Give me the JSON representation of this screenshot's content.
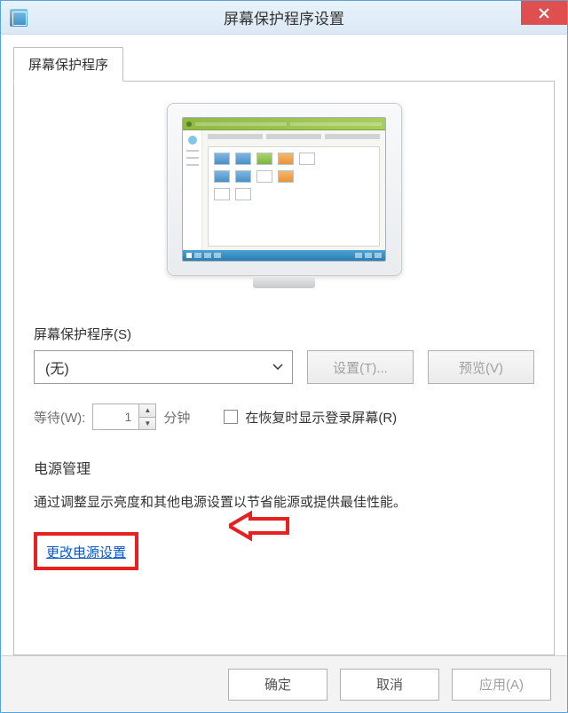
{
  "titlebar": {
    "title": "屏幕保护程序设置"
  },
  "tab": {
    "label": "屏幕保护程序"
  },
  "screensaver": {
    "group_label": "屏幕保护程序(S)",
    "selected": "(无)",
    "settings_btn": "设置(T)...",
    "preview_btn": "预览(V)"
  },
  "wait": {
    "label": "等待(W):",
    "value": "1",
    "unit": "分钟",
    "checkbox_label": "在恢复时显示登录屏幕(R)"
  },
  "power": {
    "title": "电源管理",
    "desc": "通过调整显示亮度和其他电源设置以节省能源或提供最佳性能。",
    "link": "更改电源设置"
  },
  "footer": {
    "ok": "确定",
    "cancel": "取消",
    "apply": "应用(A)"
  }
}
